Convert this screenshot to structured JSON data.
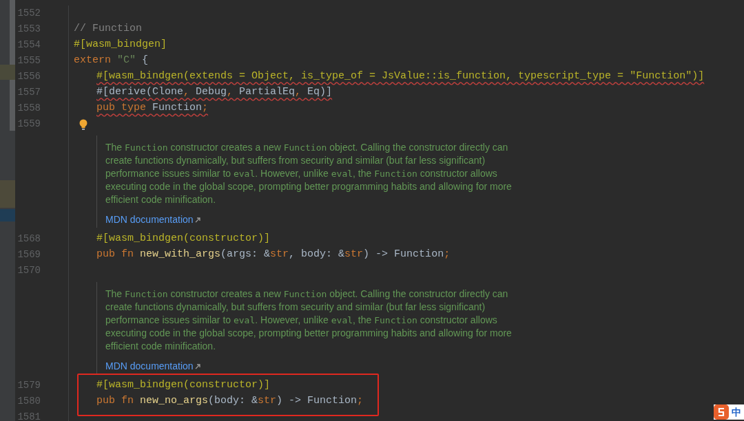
{
  "editor": {
    "rows": [
      {
        "kind": "code",
        "number": "1552"
      },
      {
        "kind": "code",
        "number": "1553",
        "tokens": [
          {
            "kind": "comment",
            "text": "// Function"
          }
        ]
      },
      {
        "kind": "code",
        "number": "1554",
        "tokens": [
          {
            "kind": "attr",
            "text": "#[wasm_bindgen]"
          }
        ]
      },
      {
        "kind": "code",
        "number": "1555",
        "tokens": [
          {
            "kind": "keyword",
            "text": "extern "
          },
          {
            "kind": "string",
            "text": "\"C\""
          },
          {
            "kind": "plain",
            "text": " {"
          }
        ],
        "children": [
          {
            "kind": "code",
            "number": "1556",
            "error": true,
            "tokens": [
              {
                "kind": "attr",
                "text": "#[wasm_bindgen(extends = Object, is_type_of = JsValue::is_function, typescript_type = \"Function\")]"
              }
            ]
          },
          {
            "kind": "code",
            "number": "1557",
            "error": true,
            "tokens": [
              {
                "kind": "plain",
                "text": "#[derive(Clone"
              },
              {
                "kind": "keyword",
                "text": ","
              },
              {
                "kind": "plain",
                "text": " Debug"
              },
              {
                "kind": "keyword",
                "text": ","
              },
              {
                "kind": "plain",
                "text": " PartialEq"
              },
              {
                "kind": "keyword",
                "text": ","
              },
              {
                "kind": "plain",
                "text": " Eq)]"
              }
            ]
          },
          {
            "kind": "code",
            "number": "1558",
            "error": true,
            "tokens": [
              {
                "kind": "keyword",
                "text": "pub type "
              },
              {
                "kind": "plain",
                "text": "Function"
              },
              {
                "kind": "keyword",
                "text": ";"
              }
            ]
          },
          {
            "kind": "code",
            "number": "1559",
            "bulb": true
          },
          {
            "kind": "doc",
            "segments": [
              {
                "kind": "text",
                "text": "The "
              },
              {
                "kind": "code",
                "text": "Function"
              },
              {
                "kind": "text",
                "text": " constructor creates a new "
              },
              {
                "kind": "code",
                "text": "Function"
              },
              {
                "kind": "text",
                "text": " object. Calling the constructor directly can create functions dynamically, but suffers from security and similar (but far less significant) performance issues similar to "
              },
              {
                "kind": "code",
                "text": "eval"
              },
              {
                "kind": "text",
                "text": ". However, unlike "
              },
              {
                "kind": "code",
                "text": "eval"
              },
              {
                "kind": "text",
                "text": ", the "
              },
              {
                "kind": "code",
                "text": "Function"
              },
              {
                "kind": "text",
                "text": " constructor allows executing code in the global scope, prompting better programming habits and allowing for more efficient code minification."
              }
            ],
            "link": "MDN documentation"
          },
          {
            "kind": "code",
            "number": "1568",
            "tokens": [
              {
                "kind": "attr",
                "text": "#[wasm_bindgen(constructor)]"
              }
            ]
          },
          {
            "kind": "code",
            "number": "1569",
            "tokens": [
              {
                "kind": "keyword",
                "text": "pub fn "
              },
              {
                "kind": "fn",
                "text": "new_with_args"
              },
              {
                "kind": "plain",
                "text": "(args: &"
              },
              {
                "kind": "keyword",
                "text": "str"
              },
              {
                "kind": "plain",
                "text": ", body: &"
              },
              {
                "kind": "keyword",
                "text": "str"
              },
              {
                "kind": "plain",
                "text": ") -> Function"
              },
              {
                "kind": "keyword",
                "text": ";"
              }
            ]
          },
          {
            "kind": "code",
            "number": "1570"
          },
          {
            "kind": "doc",
            "segments": [
              {
                "kind": "text",
                "text": "The "
              },
              {
                "kind": "code",
                "text": "Function"
              },
              {
                "kind": "text",
                "text": " constructor creates a new "
              },
              {
                "kind": "code",
                "text": "Function"
              },
              {
                "kind": "text",
                "text": " object. Calling the constructor directly can create functions dynamically, but suffers from security and similar (but far less significant) performance issues similar to "
              },
              {
                "kind": "code",
                "text": "eval"
              },
              {
                "kind": "text",
                "text": ". However, unlike "
              },
              {
                "kind": "code",
                "text": "eval"
              },
              {
                "kind": "text",
                "text": ", the "
              },
              {
                "kind": "code",
                "text": "Function"
              },
              {
                "kind": "text",
                "text": " constructor allows executing code in the global scope, prompting better programming habits and allowing for more efficient code minification."
              }
            ],
            "link": "MDN documentation"
          },
          {
            "kind": "code",
            "number": "1579",
            "boxed": true,
            "tokens": [
              {
                "kind": "attr",
                "text": "#[wasm_bindgen(constructor)]"
              }
            ]
          },
          {
            "kind": "code",
            "number": "1580",
            "boxed": true,
            "tokens": [
              {
                "kind": "keyword",
                "text": "pub fn "
              },
              {
                "kind": "fn",
                "text": "new_no_args"
              },
              {
                "kind": "plain",
                "text": "(body: &"
              },
              {
                "kind": "keyword",
                "text": "str"
              },
              {
                "kind": "plain",
                "text": ") -> Function"
              },
              {
                "kind": "keyword",
                "text": ";"
              }
            ]
          },
          {
            "kind": "code",
            "number": "1581"
          }
        ]
      }
    ]
  },
  "ime_indicator": {
    "label": "中"
  }
}
